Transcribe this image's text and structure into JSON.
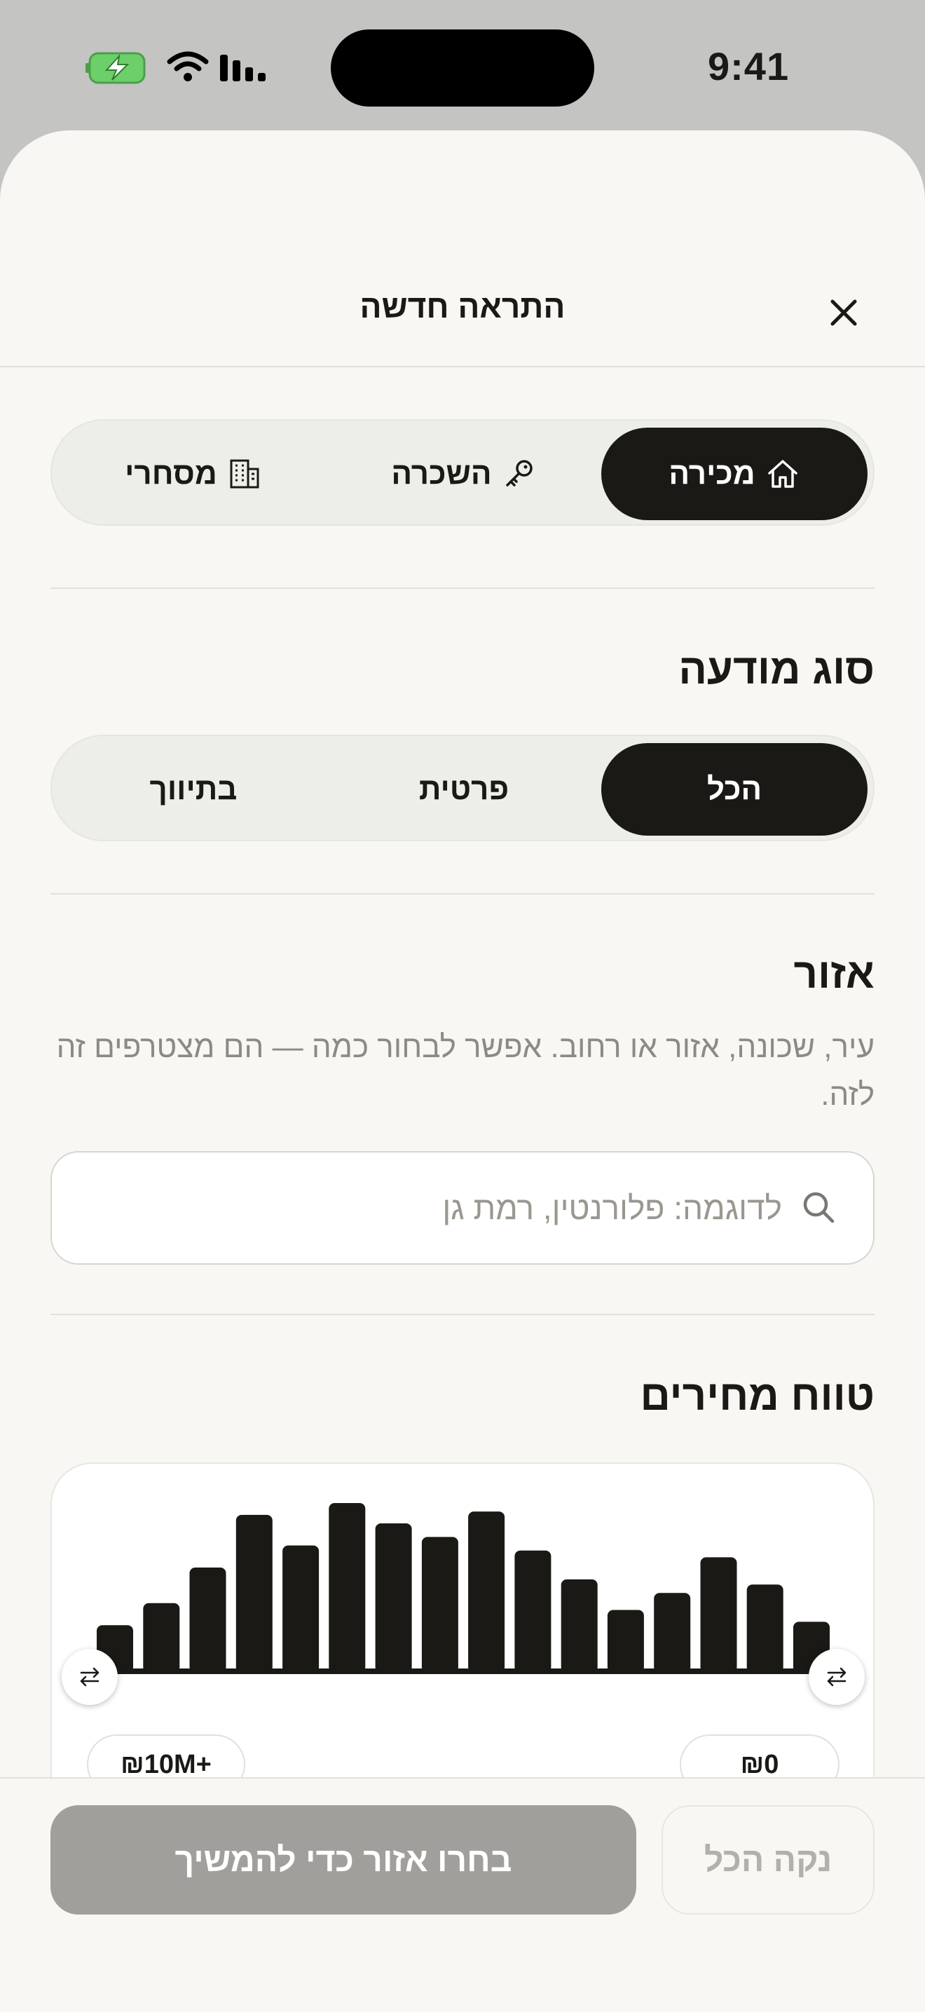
{
  "status_bar": {
    "time": "9:41"
  },
  "sheet": {
    "title": "התראה חדשה",
    "deal_type_tabs": [
      {
        "label": "מכירה",
        "icon": "home-icon",
        "active": true
      },
      {
        "label": "השכרה",
        "icon": "key-icon",
        "active": false
      },
      {
        "label": "מסחרי",
        "icon": "building-icon",
        "active": false
      }
    ],
    "listing_type": {
      "heading": "סוג מודעה",
      "options": [
        {
          "label": "הכל",
          "active": true
        },
        {
          "label": "פרטית",
          "active": false
        },
        {
          "label": "בתיווך",
          "active": false
        }
      ]
    },
    "area": {
      "heading": "אזור",
      "description": "עיר, שכונה, אזור או רחוב. אפשר לבחור כמה — הם מצטרפים זה לזה.",
      "search_placeholder": "לדוגמה: פלורנטין, רמת גן"
    },
    "price_range": {
      "heading": "טווח מחירים",
      "min_label": "₪0",
      "max_label": "₪10M+",
      "histogram_relative_heights": [
        0.28,
        0.41,
        0.62,
        0.93,
        0.75,
        1.0,
        0.88,
        0.8,
        0.95,
        0.72,
        0.55,
        0.37,
        0.47,
        0.68,
        0.52,
        0.3
      ]
    }
  },
  "footer": {
    "primary_label": "בחרו אזור כדי להמשיך",
    "secondary_label": "נקה הכל"
  },
  "colors": {
    "dark": "#1a1915",
    "background": "#f8f7f4",
    "disabled": "#a19f9b"
  }
}
